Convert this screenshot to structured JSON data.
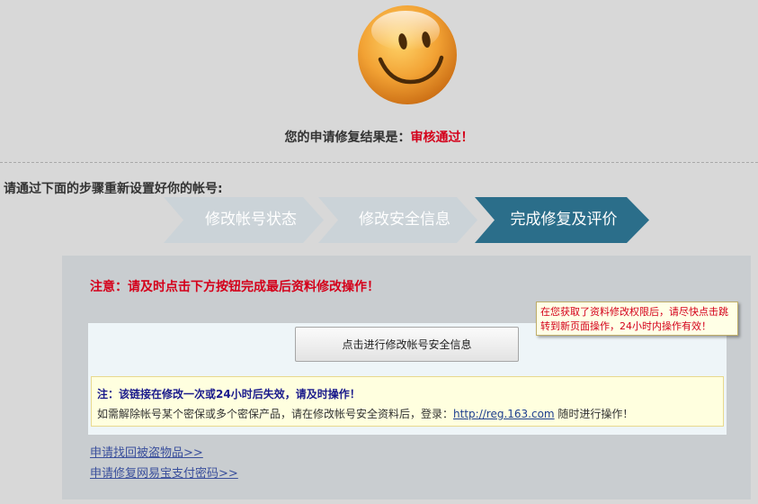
{
  "result": {
    "prefix": "您的申请修复结果是：",
    "status": "审核通过！"
  },
  "instruction": "请通过下面的步骤重新设置好你的帐号:",
  "steps": [
    {
      "label": "修改帐号状态",
      "state": "done"
    },
    {
      "label": "修改安全信息",
      "state": "done"
    },
    {
      "label": "完成修复及评价",
      "state": "active"
    }
  ],
  "notice": "注意：请及时点击下方按钮完成最后资料修改操作！",
  "tooltip": "在您获取了资料修改权限后，请尽快点击跳转到新页面操作，24小时内操作有效！",
  "action_button": "点击进行修改帐号安全信息",
  "info": {
    "line1": "注：该链接在修改一次或24小时后失效，请及时操作！",
    "line2_before": "如需解除帐号某个密保或多个密保产品，请在修改帐号安全资料后，登录：",
    "link": "http://reg.163.com",
    "line2_after": " 随时进行操作！"
  },
  "links": [
    "申请找回被盗物品>>",
    "申请修复网易宝支付密码>>"
  ],
  "colors": {
    "accent_red": "#d4001a",
    "active_step": "#2b6e8a",
    "inactive_step": "#cbd3d8",
    "link_blue": "#3a4f9c"
  }
}
